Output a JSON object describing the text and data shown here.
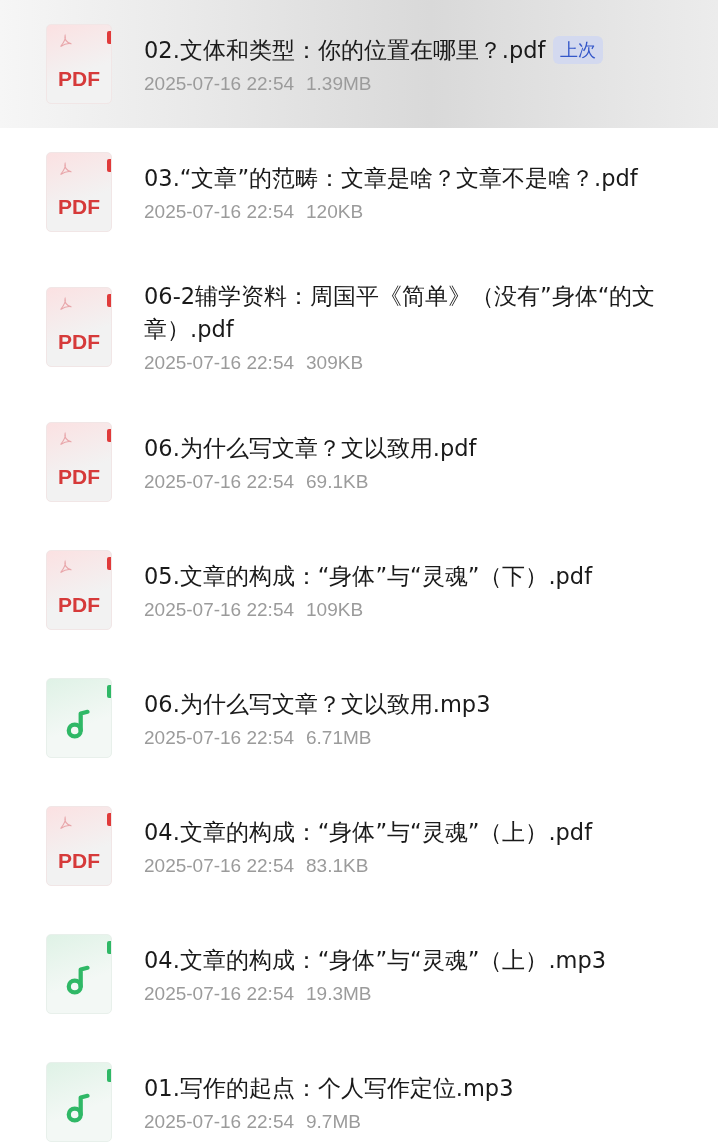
{
  "files": [
    {
      "kind": "pdf",
      "icon_label": "PDF",
      "name": "02.文体和类型：你的位置在哪里？.pdf",
      "badge": "上次",
      "selected": true,
      "date": "2025-07-16 22:54",
      "size": "1.39MB"
    },
    {
      "kind": "pdf",
      "icon_label": "PDF",
      "name": "03.“文章”的范畴：文章是啥？文章不是啥？.pdf",
      "selected": false,
      "date": "2025-07-16 22:54",
      "size": "120KB"
    },
    {
      "kind": "pdf",
      "icon_label": "PDF",
      "name": "06-2辅学资料：周国平《简单》（没有”身体“的文章）.pdf",
      "selected": false,
      "date": "2025-07-16 22:54",
      "size": "309KB"
    },
    {
      "kind": "pdf",
      "icon_label": "PDF",
      "name": "06.为什么写文章？文以致用.pdf",
      "selected": false,
      "date": "2025-07-16 22:54",
      "size": "69.1KB"
    },
    {
      "kind": "pdf",
      "icon_label": "PDF",
      "name": "05.文章的构成：“身体”与“灵魂”（下）.pdf",
      "selected": false,
      "date": "2025-07-16 22:54",
      "size": "109KB"
    },
    {
      "kind": "audio",
      "name": "06.为什么写文章？文以致用.mp3",
      "selected": false,
      "date": "2025-07-16 22:54",
      "size": "6.71MB"
    },
    {
      "kind": "pdf",
      "icon_label": "PDF",
      "name": "04.文章的构成：“身体”与“灵魂”（上）.pdf",
      "selected": false,
      "date": "2025-07-16 22:54",
      "size": "83.1KB"
    },
    {
      "kind": "audio",
      "name": "04.文章的构成：“身体”与“灵魂”（上）.mp3",
      "selected": false,
      "date": "2025-07-16 22:54",
      "size": "19.3MB"
    },
    {
      "kind": "audio",
      "name": "01.写作的起点：个人写作定位.mp3",
      "selected": false,
      "date": "2025-07-16 22:54",
      "size": "9.7MB"
    }
  ]
}
